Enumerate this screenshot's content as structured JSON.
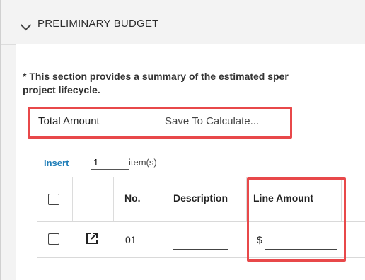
{
  "section": {
    "title": "PRELIMINARY BUDGET"
  },
  "note": {
    "line1": "* This section provides a summary of the estimated sper",
    "line2": "project lifecycle."
  },
  "total": {
    "label": "Total Amount",
    "value": "Save To Calculate..."
  },
  "insert": {
    "link_label": "Insert",
    "quantity": "1",
    "unit_label": "item(s)"
  },
  "table": {
    "headers": {
      "no": "No.",
      "description": "Description",
      "line_amount": "Line Amount"
    },
    "rows": [
      {
        "no": "01",
        "description": "",
        "currency": "$",
        "amount": ""
      }
    ]
  },
  "colors": {
    "highlight": "#e8484a",
    "link": "#1f7eb8"
  },
  "icons": {
    "section_toggle": "chevron-down-icon",
    "row_open": "open-external-icon"
  }
}
